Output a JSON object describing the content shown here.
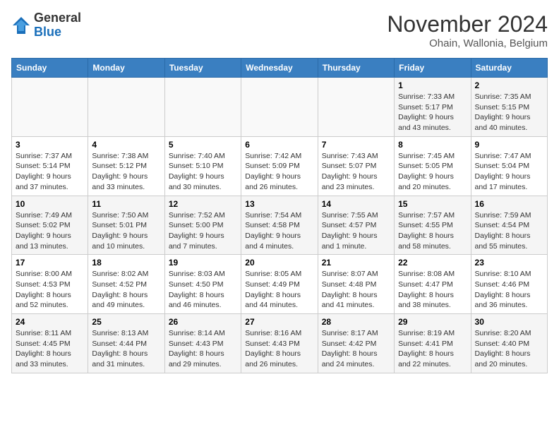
{
  "header": {
    "logo_general": "General",
    "logo_blue": "Blue",
    "month_title": "November 2024",
    "location": "Ohain, Wallonia, Belgium"
  },
  "weekdays": [
    "Sunday",
    "Monday",
    "Tuesday",
    "Wednesday",
    "Thursday",
    "Friday",
    "Saturday"
  ],
  "weeks": [
    [
      {
        "day": "",
        "sunrise": "",
        "sunset": "",
        "daylight": ""
      },
      {
        "day": "",
        "sunrise": "",
        "sunset": "",
        "daylight": ""
      },
      {
        "day": "",
        "sunrise": "",
        "sunset": "",
        "daylight": ""
      },
      {
        "day": "",
        "sunrise": "",
        "sunset": "",
        "daylight": ""
      },
      {
        "day": "",
        "sunrise": "",
        "sunset": "",
        "daylight": ""
      },
      {
        "day": "1",
        "sunrise": "Sunrise: 7:33 AM",
        "sunset": "Sunset: 5:17 PM",
        "daylight": "Daylight: 9 hours and 43 minutes."
      },
      {
        "day": "2",
        "sunrise": "Sunrise: 7:35 AM",
        "sunset": "Sunset: 5:15 PM",
        "daylight": "Daylight: 9 hours and 40 minutes."
      }
    ],
    [
      {
        "day": "3",
        "sunrise": "Sunrise: 7:37 AM",
        "sunset": "Sunset: 5:14 PM",
        "daylight": "Daylight: 9 hours and 37 minutes."
      },
      {
        "day": "4",
        "sunrise": "Sunrise: 7:38 AM",
        "sunset": "Sunset: 5:12 PM",
        "daylight": "Daylight: 9 hours and 33 minutes."
      },
      {
        "day": "5",
        "sunrise": "Sunrise: 7:40 AM",
        "sunset": "Sunset: 5:10 PM",
        "daylight": "Daylight: 9 hours and 30 minutes."
      },
      {
        "day": "6",
        "sunrise": "Sunrise: 7:42 AM",
        "sunset": "Sunset: 5:09 PM",
        "daylight": "Daylight: 9 hours and 26 minutes."
      },
      {
        "day": "7",
        "sunrise": "Sunrise: 7:43 AM",
        "sunset": "Sunset: 5:07 PM",
        "daylight": "Daylight: 9 hours and 23 minutes."
      },
      {
        "day": "8",
        "sunrise": "Sunrise: 7:45 AM",
        "sunset": "Sunset: 5:05 PM",
        "daylight": "Daylight: 9 hours and 20 minutes."
      },
      {
        "day": "9",
        "sunrise": "Sunrise: 7:47 AM",
        "sunset": "Sunset: 5:04 PM",
        "daylight": "Daylight: 9 hours and 17 minutes."
      }
    ],
    [
      {
        "day": "10",
        "sunrise": "Sunrise: 7:49 AM",
        "sunset": "Sunset: 5:02 PM",
        "daylight": "Daylight: 9 hours and 13 minutes."
      },
      {
        "day": "11",
        "sunrise": "Sunrise: 7:50 AM",
        "sunset": "Sunset: 5:01 PM",
        "daylight": "Daylight: 9 hours and 10 minutes."
      },
      {
        "day": "12",
        "sunrise": "Sunrise: 7:52 AM",
        "sunset": "Sunset: 5:00 PM",
        "daylight": "Daylight: 9 hours and 7 minutes."
      },
      {
        "day": "13",
        "sunrise": "Sunrise: 7:54 AM",
        "sunset": "Sunset: 4:58 PM",
        "daylight": "Daylight: 9 hours and 4 minutes."
      },
      {
        "day": "14",
        "sunrise": "Sunrise: 7:55 AM",
        "sunset": "Sunset: 4:57 PM",
        "daylight": "Daylight: 9 hours and 1 minute."
      },
      {
        "day": "15",
        "sunrise": "Sunrise: 7:57 AM",
        "sunset": "Sunset: 4:55 PM",
        "daylight": "Daylight: 8 hours and 58 minutes."
      },
      {
        "day": "16",
        "sunrise": "Sunrise: 7:59 AM",
        "sunset": "Sunset: 4:54 PM",
        "daylight": "Daylight: 8 hours and 55 minutes."
      }
    ],
    [
      {
        "day": "17",
        "sunrise": "Sunrise: 8:00 AM",
        "sunset": "Sunset: 4:53 PM",
        "daylight": "Daylight: 8 hours and 52 minutes."
      },
      {
        "day": "18",
        "sunrise": "Sunrise: 8:02 AM",
        "sunset": "Sunset: 4:52 PM",
        "daylight": "Daylight: 8 hours and 49 minutes."
      },
      {
        "day": "19",
        "sunrise": "Sunrise: 8:03 AM",
        "sunset": "Sunset: 4:50 PM",
        "daylight": "Daylight: 8 hours and 46 minutes."
      },
      {
        "day": "20",
        "sunrise": "Sunrise: 8:05 AM",
        "sunset": "Sunset: 4:49 PM",
        "daylight": "Daylight: 8 hours and 44 minutes."
      },
      {
        "day": "21",
        "sunrise": "Sunrise: 8:07 AM",
        "sunset": "Sunset: 4:48 PM",
        "daylight": "Daylight: 8 hours and 41 minutes."
      },
      {
        "day": "22",
        "sunrise": "Sunrise: 8:08 AM",
        "sunset": "Sunset: 4:47 PM",
        "daylight": "Daylight: 8 hours and 38 minutes."
      },
      {
        "day": "23",
        "sunrise": "Sunrise: 8:10 AM",
        "sunset": "Sunset: 4:46 PM",
        "daylight": "Daylight: 8 hours and 36 minutes."
      }
    ],
    [
      {
        "day": "24",
        "sunrise": "Sunrise: 8:11 AM",
        "sunset": "Sunset: 4:45 PM",
        "daylight": "Daylight: 8 hours and 33 minutes."
      },
      {
        "day": "25",
        "sunrise": "Sunrise: 8:13 AM",
        "sunset": "Sunset: 4:44 PM",
        "daylight": "Daylight: 8 hours and 31 minutes."
      },
      {
        "day": "26",
        "sunrise": "Sunrise: 8:14 AM",
        "sunset": "Sunset: 4:43 PM",
        "daylight": "Daylight: 8 hours and 29 minutes."
      },
      {
        "day": "27",
        "sunrise": "Sunrise: 8:16 AM",
        "sunset": "Sunset: 4:43 PM",
        "daylight": "Daylight: 8 hours and 26 minutes."
      },
      {
        "day": "28",
        "sunrise": "Sunrise: 8:17 AM",
        "sunset": "Sunset: 4:42 PM",
        "daylight": "Daylight: 8 hours and 24 minutes."
      },
      {
        "day": "29",
        "sunrise": "Sunrise: 8:19 AM",
        "sunset": "Sunset: 4:41 PM",
        "daylight": "Daylight: 8 hours and 22 minutes."
      },
      {
        "day": "30",
        "sunrise": "Sunrise: 8:20 AM",
        "sunset": "Sunset: 4:40 PM",
        "daylight": "Daylight: 8 hours and 20 minutes."
      }
    ]
  ]
}
